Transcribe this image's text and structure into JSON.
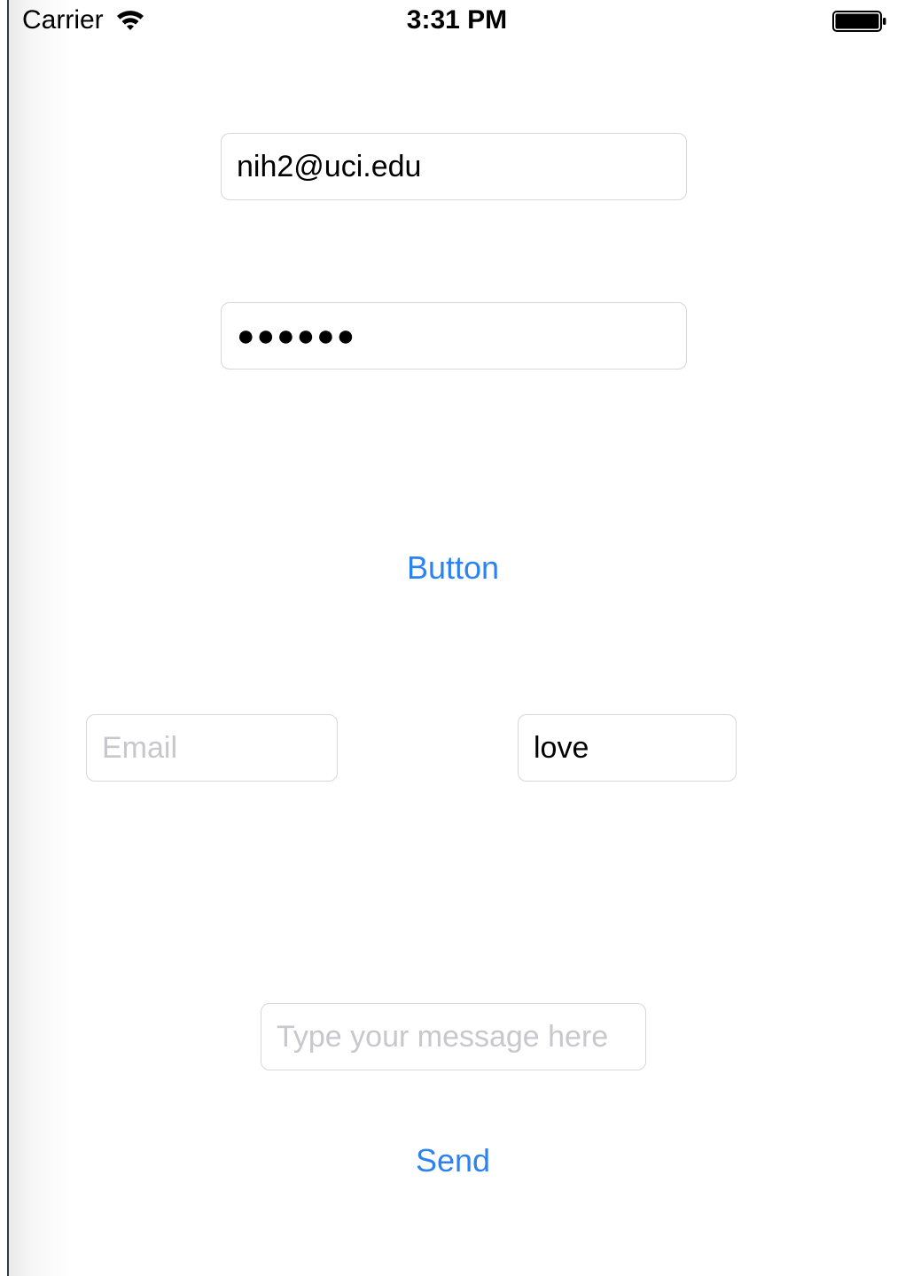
{
  "status_bar": {
    "carrier": "Carrier",
    "time": "3:31 PM",
    "wifi_icon": "wifi-icon",
    "battery_icon": "battery-icon"
  },
  "login": {
    "email_value": "nih2@uci.edu",
    "password_masked": "●●●●●●",
    "button_label": "Button"
  },
  "row_fields": {
    "email_placeholder": "Email",
    "second_value": "love"
  },
  "message": {
    "placeholder": "Type your message here",
    "send_label": "Send"
  },
  "colors": {
    "accent": "#2d82f2",
    "border": "#d7d7d7",
    "placeholder": "#c7c7cd"
  }
}
